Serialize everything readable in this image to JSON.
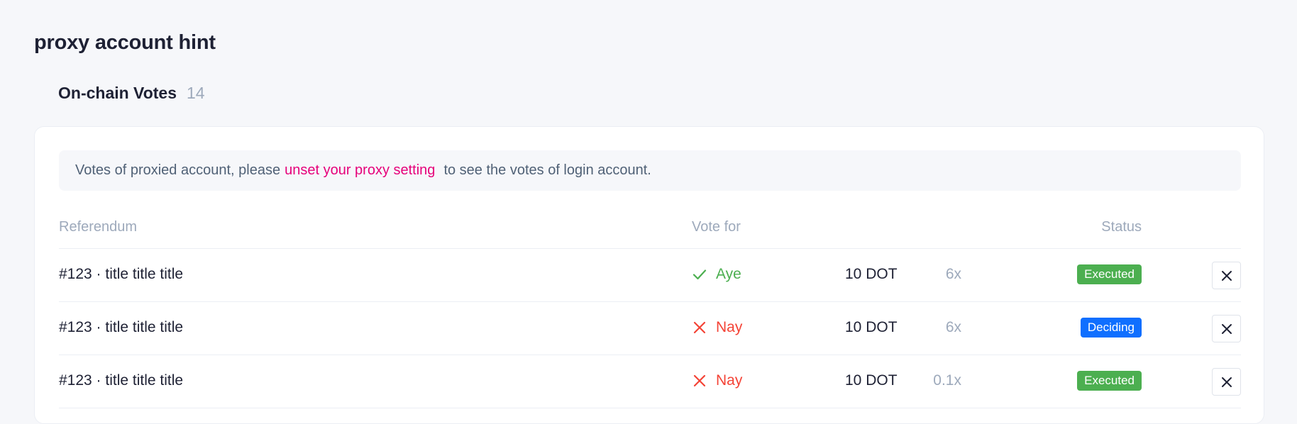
{
  "page": {
    "title": "proxy account hint"
  },
  "section": {
    "title": "On-chain Votes",
    "count": "14"
  },
  "hint": {
    "prefix": "Votes of proxied account, please",
    "link": "unset your proxy setting",
    "suffix": "to see the votes of login account."
  },
  "table": {
    "headers": {
      "referendum": "Referendum",
      "vote_for": "Vote for",
      "status": "Status"
    },
    "rows": [
      {
        "referendum": "#123 · title title title",
        "vote": "Aye",
        "vote_icon": "check-icon",
        "amount": "10 DOT",
        "conviction": "6x",
        "status": "Executed",
        "status_color": "#4caf50"
      },
      {
        "referendum": "#123 · title title title",
        "vote": "Nay",
        "vote_icon": "cross-icon",
        "amount": "10 DOT",
        "conviction": "6x",
        "status": "Deciding",
        "status_color": "#0f6fff"
      },
      {
        "referendum": "#123 · title title title",
        "vote": "Nay",
        "vote_icon": "cross-icon",
        "amount": "10 DOT",
        "conviction": "0.1x",
        "status": "Executed",
        "status_color": "#4caf50"
      }
    ]
  },
  "colors": {
    "accent": "#e6007a",
    "aye": "#4caf50",
    "nay": "#f44336"
  }
}
